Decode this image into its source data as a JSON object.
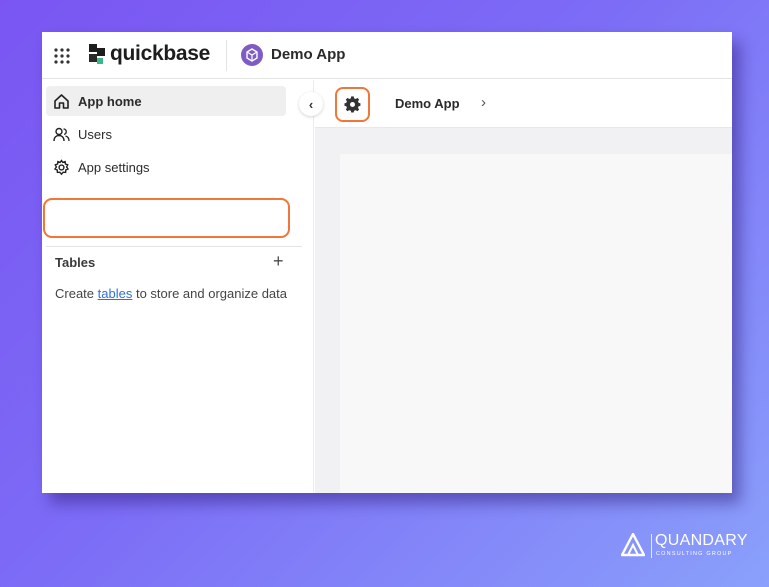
{
  "topbar": {
    "grid_icon": "grid-icon",
    "logo_text": "quickbase",
    "app_name": "Demo App"
  },
  "sidebar": {
    "items": [
      {
        "label": "App home",
        "icon": "home-icon",
        "active": true
      },
      {
        "label": "Users",
        "icon": "users-icon",
        "active": false
      },
      {
        "label": "App settings",
        "icon": "gear-icon",
        "active": false,
        "highlighted": true
      }
    ],
    "tables": {
      "heading": "Tables",
      "add_label": "+",
      "empty_prefix": "Create ",
      "empty_link": "tables",
      "empty_suffix": " to store and organize data"
    }
  },
  "main": {
    "collapse_label": "‹",
    "breadcrumb": "Demo App",
    "breadcrumb_chevron": "›"
  },
  "branding": {
    "name": "QUANDARY",
    "subtitle": "CONSULTING GROUP"
  },
  "colors": {
    "highlight": "#f0763a",
    "link": "#2f6fd8",
    "app_icon": "#7f5cc4"
  }
}
